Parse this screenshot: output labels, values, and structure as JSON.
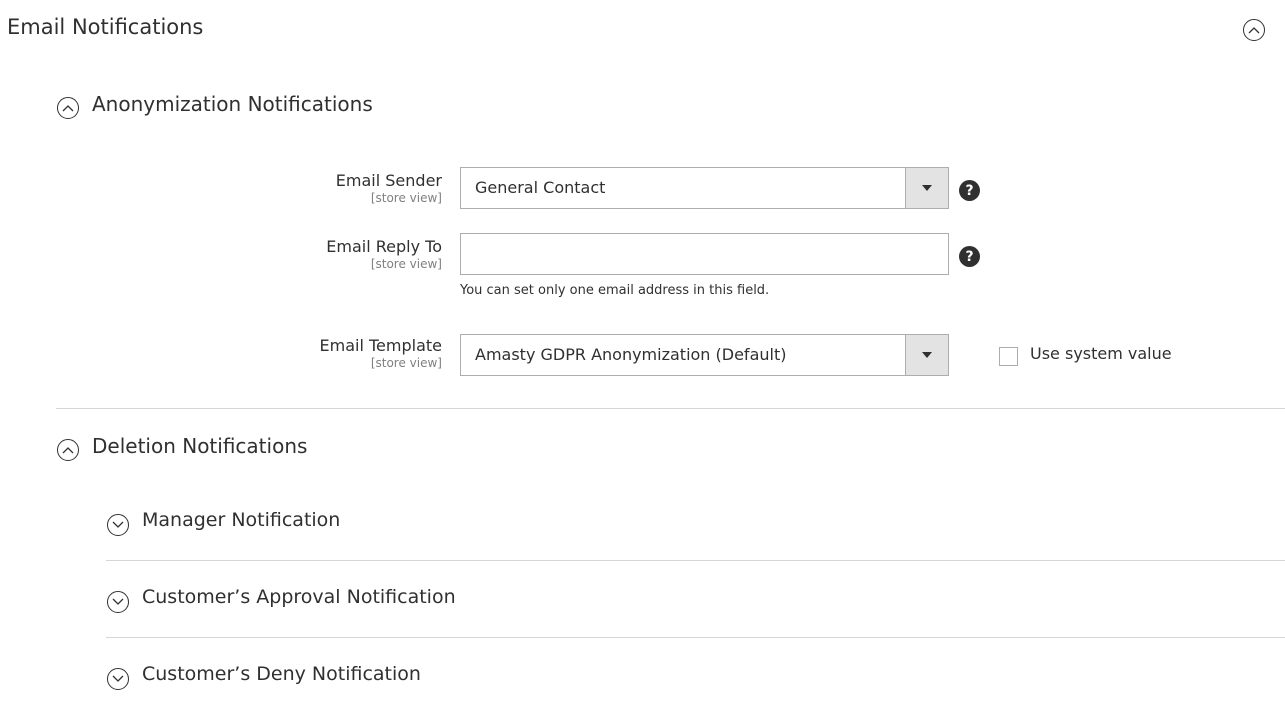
{
  "main": {
    "title": "Email Notifications"
  },
  "anonymization": {
    "title": "Anonymization Notifications",
    "fields": {
      "sender": {
        "label": "Email Sender",
        "scope": "[store view]",
        "value": "General Contact"
      },
      "reply_to": {
        "label": "Email Reply To",
        "scope": "[store view]",
        "value": "",
        "note": "You can set only one email address in this field."
      },
      "template": {
        "label": "Email Template",
        "scope": "[store view]",
        "value": "Amasty GDPR Anonymization (Default)",
        "use_system_value_label": "Use system value",
        "use_system_value_checked": false
      }
    }
  },
  "deletion": {
    "title": "Deletion Notifications",
    "subsections": [
      {
        "title": "Manager Notification"
      },
      {
        "title": "Customer’s Approval Notification"
      },
      {
        "title": "Customer’s Deny Notification"
      }
    ]
  },
  "icons": {
    "help": "?",
    "collapse": "chevron-up-icon",
    "expand": "chevron-down-icon",
    "dropdown": "triangle-down-icon"
  }
}
